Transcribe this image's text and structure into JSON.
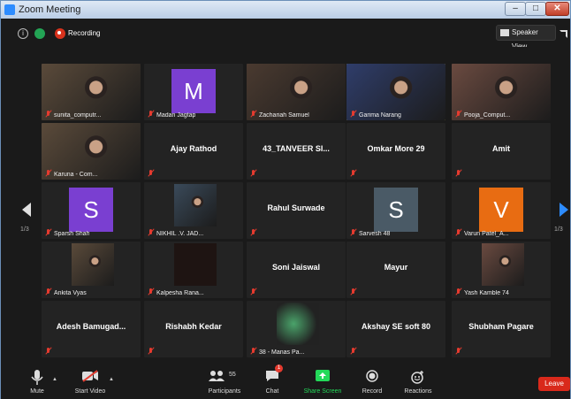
{
  "window": {
    "title": "Zoom Meeting",
    "min_label": "–",
    "max_label": "□",
    "close_label": "✕"
  },
  "topbar": {
    "recording_label": "Recording",
    "speaker_view_label": "Speaker View",
    "info_icon": "i"
  },
  "colors": {
    "accent": "#2d8cff",
    "leave": "#d9291b",
    "share": "#23d959",
    "active_speaker": "#e6e24a"
  },
  "tiles": [
    {
      "name": "sunita_computr...",
      "kind": "video"
    },
    {
      "name": "Madan Jagtap",
      "kind": "avatar",
      "letter": "M",
      "color": "#7a3fd1"
    },
    {
      "name": "Zachariah Samuel",
      "kind": "video"
    },
    {
      "name": "Garima Narang",
      "kind": "video",
      "active": true
    },
    {
      "name": "Pooja_Comput...",
      "kind": "video"
    },
    {
      "name": "Karuna - Com...",
      "kind": "video"
    },
    {
      "name": "Ajay Rathod",
      "kind": "text"
    },
    {
      "name": "43_TANVEER SI...",
      "kind": "text"
    },
    {
      "name": "Omkar More 29",
      "kind": "text"
    },
    {
      "name": "Amit",
      "kind": "text"
    },
    {
      "name": "Sparsh Shah",
      "kind": "avatar",
      "letter": "S",
      "color": "#7a3fd1"
    },
    {
      "name": "NIKHIL .V. JAD...",
      "kind": "video"
    },
    {
      "name": "Rahul Surwade",
      "kind": "text"
    },
    {
      "name": "Sarvesh 48",
      "kind": "avatar",
      "letter": "S",
      "color": "#4a5a66"
    },
    {
      "name": "Varun Patel_A...",
      "kind": "avatar",
      "letter": "V",
      "color": "#e86c12"
    },
    {
      "name": "Ankita Vyas",
      "kind": "video"
    },
    {
      "name": "Kalpesha Rana...",
      "kind": "video"
    },
    {
      "name": "Soni Jaiswal",
      "kind": "text"
    },
    {
      "name": "Mayur",
      "kind": "text"
    },
    {
      "name": "Yash Kamble 74",
      "kind": "video"
    },
    {
      "name": "Adesh Bamugad...",
      "kind": "text"
    },
    {
      "name": "Rishabh Kedar",
      "kind": "text"
    },
    {
      "name": "38 - Manas Pa...",
      "kind": "video"
    },
    {
      "name": "Akshay SE soft 80",
      "kind": "text"
    },
    {
      "name": "Shubham Pagare",
      "kind": "text"
    }
  ],
  "pagination": {
    "left": "1/3",
    "right": "1/3"
  },
  "bottombar": {
    "mute": "Mute",
    "start_video": "Start Video",
    "participants": "Participants",
    "participants_count": "55",
    "chat": "Chat",
    "chat_badge": "1",
    "share_screen": "Share Screen",
    "record": "Record",
    "reactions": "Reactions",
    "leave": "Leave"
  }
}
